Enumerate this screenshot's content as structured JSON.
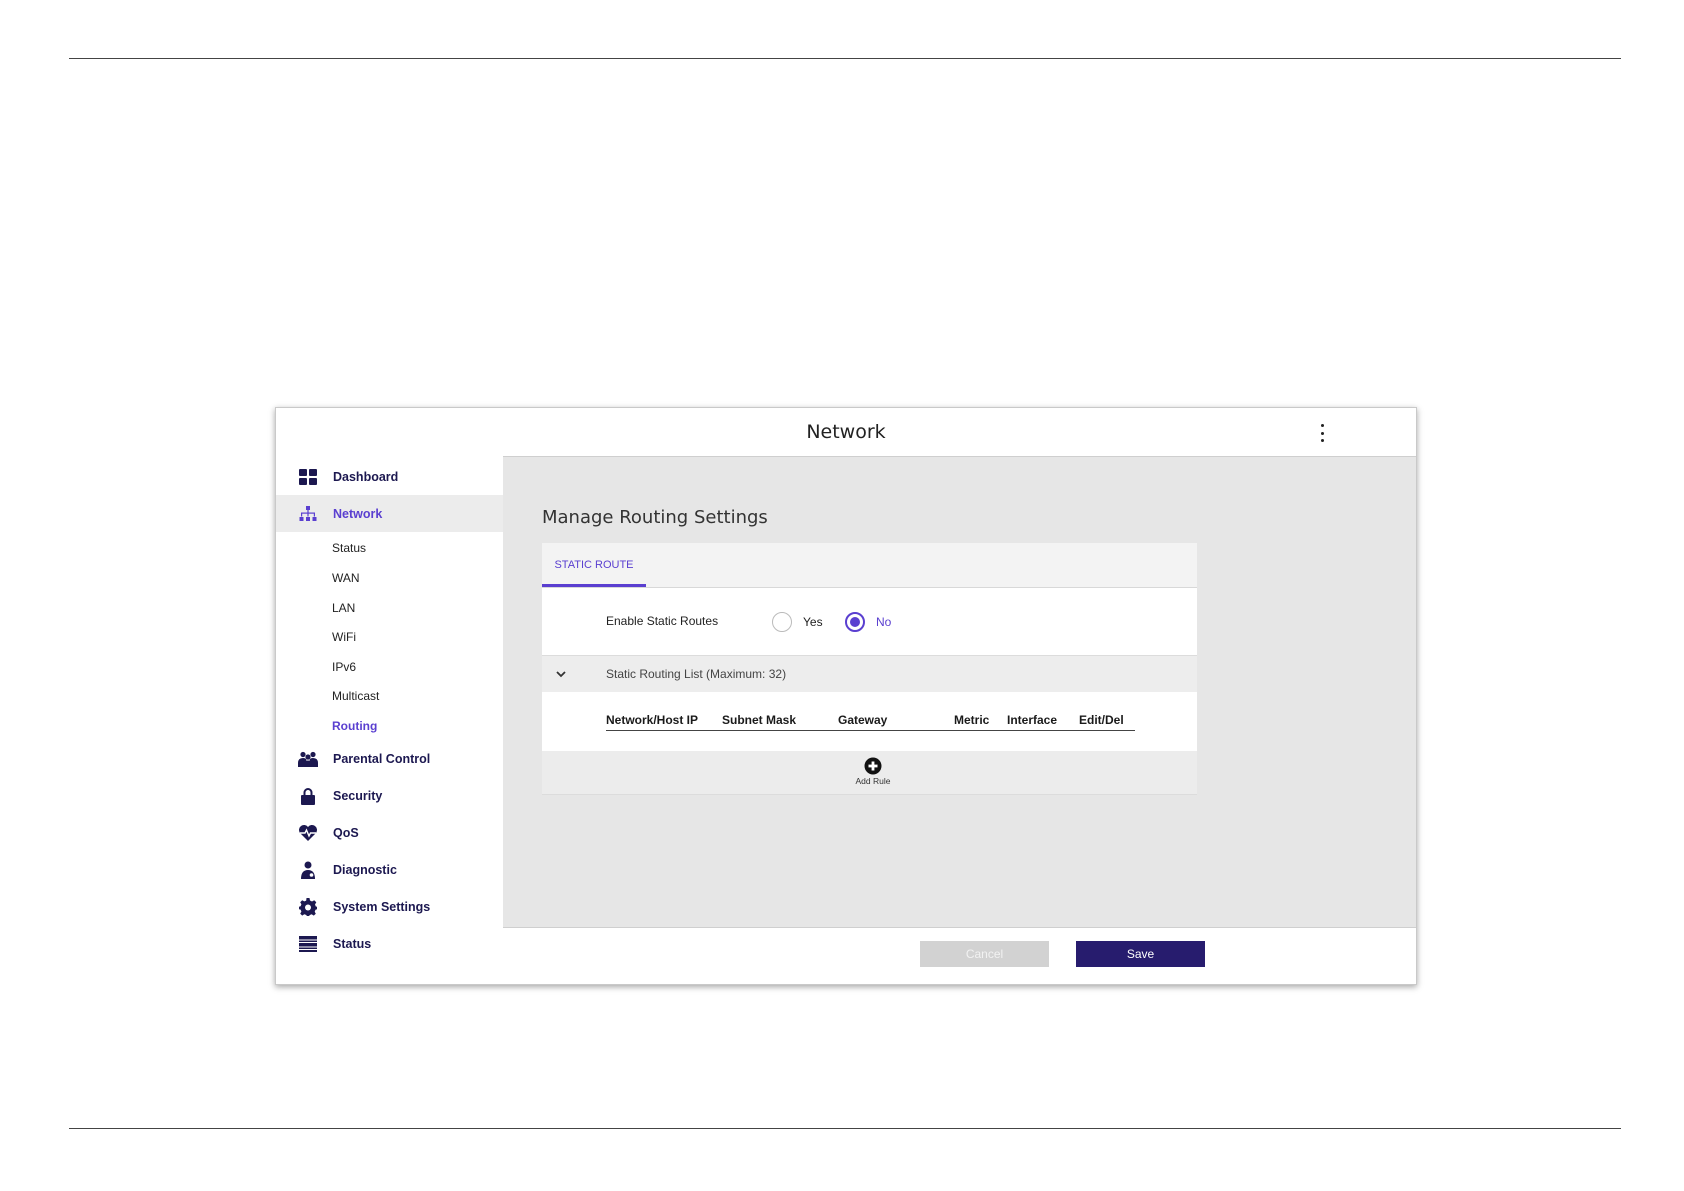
{
  "window": {
    "title": "Network"
  },
  "sidebar": {
    "items": [
      {
        "label": "Dashboard",
        "icon": "dashboard-icon"
      },
      {
        "label": "Network",
        "icon": "network-icon",
        "active": true
      },
      {
        "label": "Parental Control",
        "icon": "parental-control-icon"
      },
      {
        "label": "Security",
        "icon": "lock-icon"
      },
      {
        "label": "QoS",
        "icon": "qos-heartbeat-icon"
      },
      {
        "label": "Diagnostic",
        "icon": "diagnostic-icon"
      },
      {
        "label": "System Settings",
        "icon": "gear-icon"
      },
      {
        "label": "Status",
        "icon": "status-icon"
      }
    ],
    "network_sub": [
      "Status",
      "WAN",
      "LAN",
      "WiFi",
      "IPv6",
      "Multicast",
      "Routing"
    ],
    "active_sub": "Routing"
  },
  "main": {
    "heading": "Manage Routing Settings",
    "tab": "STATIC ROUTE",
    "enable_label": "Enable Static Routes",
    "radio_yes": "Yes",
    "radio_no": "No",
    "selected": "No",
    "list_title": "Static Routing List (Maximum: 32)",
    "columns": [
      "Network/Host IP",
      "Subnet Mask",
      "Gateway",
      "Metric",
      "Interface",
      "Edit/Del"
    ],
    "add_rule": "Add Rule"
  },
  "footer": {
    "cancel": "Cancel",
    "save": "Save"
  },
  "colors": {
    "accent": "#5a3fd0",
    "brand_dark": "#271c6e",
    "content_bg": "#e6e6e6"
  }
}
